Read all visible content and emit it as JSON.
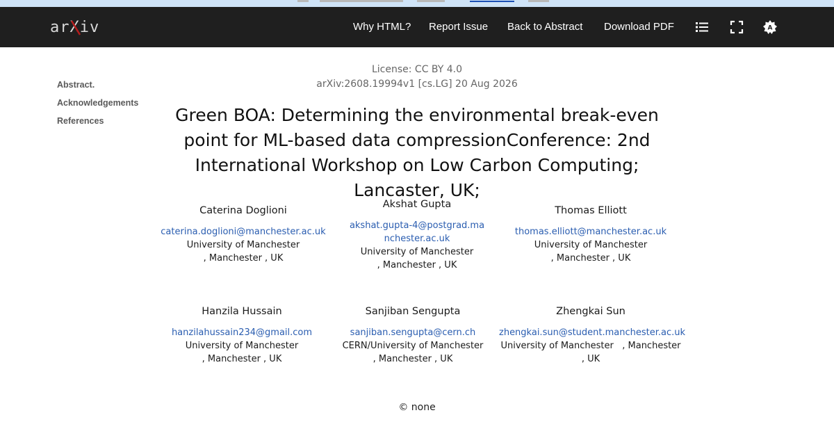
{
  "nav": {
    "logo_text": "arXiv",
    "links": [
      "Why HTML?",
      "Report Issue",
      "Back to Abstract",
      "Download PDF"
    ],
    "icons": [
      "list-icon",
      "fullscreen-icon",
      "theme-toggle-icon"
    ]
  },
  "toc": [
    "Abstract.",
    "Acknowledgements",
    "References"
  ],
  "meta": {
    "license": "License: CC BY 4.0",
    "arxiv_id": "arXiv:2608.19994v1 [cs.LG] 20 Aug 2026"
  },
  "title": "Green BOA: Determining the environmental break-even point for ML-based data compressionConference: 2nd International Workshop on Low Carbon Computing; Lancaster, UK;",
  "authors": [
    {
      "name": "Caterina Doglioni",
      "email": "caterina.doglioni@manchester.ac.uk",
      "lines": [
        "University of Manchester",
        ", Manchester ,  UK"
      ]
    },
    {
      "name": "Akshat Gupta",
      "email": "akshat.gupta-4@postgrad.manchester.ac.uk",
      "lines": [
        "University of Manchester",
        ", Manchester ,  UK"
      ]
    },
    {
      "name": "Thomas Elliott",
      "email": "thomas.elliott@manchester.ac.uk",
      "lines": [
        "University of Manchester",
        ", Manchester ,  UK"
      ]
    },
    {
      "name": "Hanzila Hussain",
      "email": "hanzilahussain234@gmail.com",
      "lines": [
        "University of Manchester",
        ", Manchester ,  UK"
      ]
    },
    {
      "name": "Sanjiban Sengupta",
      "email": "sanjiban.sengupta@cern.ch",
      "lines": [
        "CERN/University of Manchester",
        ", Manchester ,  UK"
      ]
    },
    {
      "name": "Zhengkai Sun",
      "email": "zhengkai.sun@student.manchester.ac.uk",
      "lines": [
        "University of Manchester   , Manchester",
        ",  UK"
      ]
    }
  ],
  "copyright": "© none"
}
